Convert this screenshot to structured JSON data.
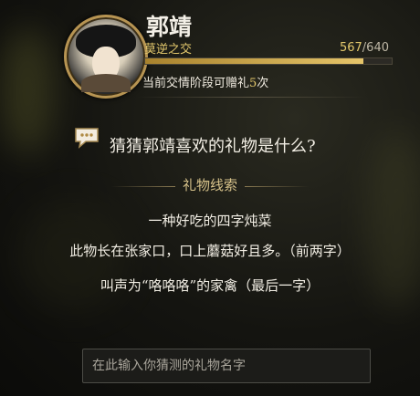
{
  "character": {
    "name": "郭靖",
    "relation": "莫逆之交",
    "friendship_current": "567",
    "friendship_max": "/640",
    "friendship_progress": 0.886,
    "gift_prefix": "当前交情阶段可赠礼",
    "gift_count": "5",
    "gift_suffix": "次"
  },
  "quiz": {
    "question": "猜猜郭靖喜欢的礼物是什么?",
    "hint_title": "礼物线索",
    "clues": [
      "一种好吃的四字炖菜",
      "此物长在张家口，口上蘑菇好且多。（前两字）",
      "叫声为“咯咯咯”的家禽（最后一字）"
    ]
  },
  "input": {
    "placeholder": "在此输入你猜测的礼物名字"
  },
  "colors": {
    "accent_gold": "#e3c86c",
    "text_main": "#f2eee4"
  },
  "icons": {
    "chat": "chat-bubble-icon"
  }
}
